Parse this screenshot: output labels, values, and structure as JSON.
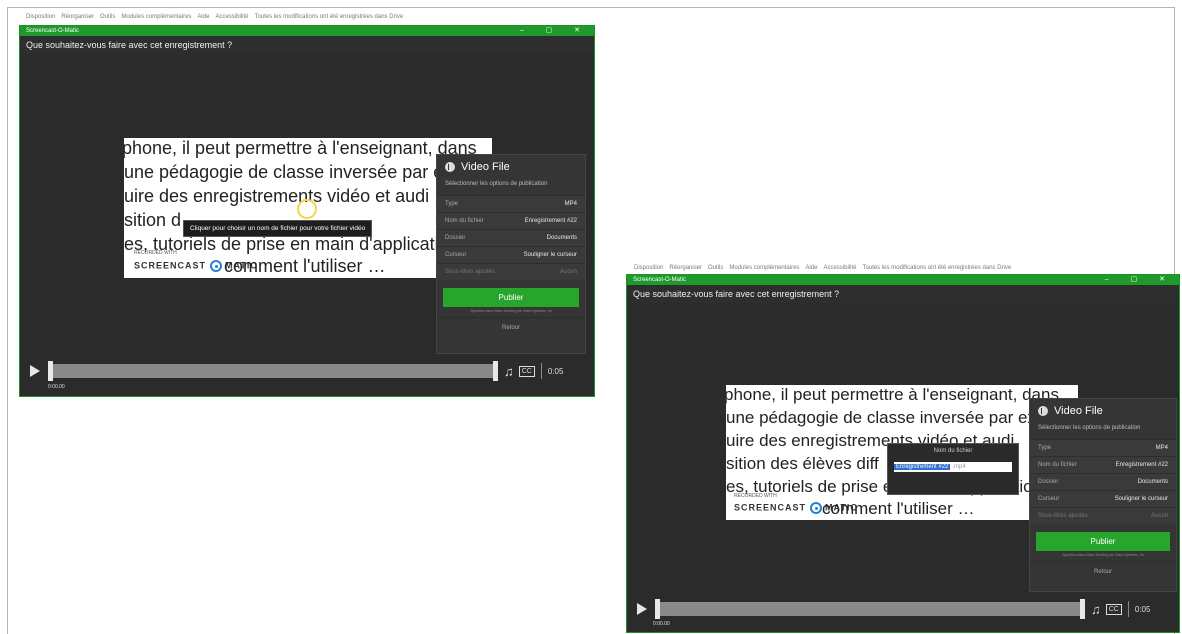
{
  "menu": [
    "Disposition",
    "Réorganiser",
    "Outils",
    "Modules complémentaires",
    "Aide",
    "Accessibilité",
    "Toutes les modifications ont été enregistrées dans Drive"
  ],
  "window": {
    "app_title": "Screencast-O-Matic",
    "controls": "–  ▢  ✕",
    "question": "Que souhaitez-vous faire avec cet enregistrement ?"
  },
  "slide": {
    "lines": [
      "phone, il peut permettre à l'enseignant, dans",
      "une pédagogie de classe inversée par ex",
      "uire des enregistrements vidéo et audi",
      "sition des élèves diff",
      "es, tutoriels de prise en main d'applicatio",
      "comment l'utiliser …"
    ],
    "line4_left": "sition d",
    "watermark_top": "RECORDED WITH",
    "watermark_brand": "SCREENCAST",
    "watermark_tail": "MATIC"
  },
  "panel": {
    "title": "Video File",
    "subtitle": "Sélectionner les options de publication",
    "rows": [
      {
        "k": "Type",
        "v": "MP4"
      },
      {
        "k": "Nom du fichier",
        "v": "Enregistrement #22"
      },
      {
        "k": "Dossier",
        "v": "Documents"
      },
      {
        "k": "Curseur",
        "v": "Souligner le curseur"
      },
      {
        "k": "Sous-titres ajoutés",
        "v": "Aucun"
      }
    ],
    "publish": "Publier",
    "fine": "Specifiez dans Video Hosting par Video Systems, ne",
    "back": "Retour"
  },
  "tooltip": "Cliquer pour choisir un nom de fichier pour votre fichier vidéo",
  "filename_popup": {
    "title": "Nom du fichier",
    "selected": "Enregistrement #22",
    "ext": ".mp4"
  },
  "player": {
    "timestamp": "0:00.00",
    "duration": "0:05",
    "cc": "CC"
  }
}
